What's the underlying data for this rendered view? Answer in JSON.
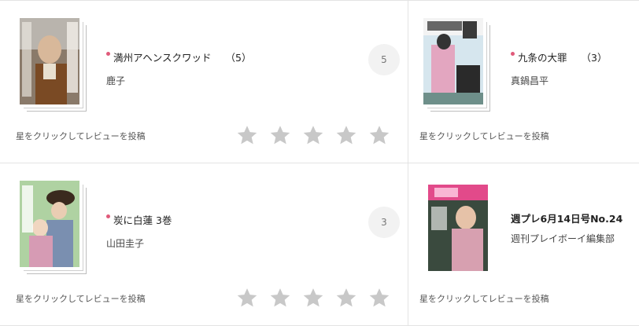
{
  "colors": {
    "accent_dot": "#e05a7a",
    "star": "#c8c8c8",
    "badge_bg": "#f2f2f2"
  },
  "cards": [
    {
      "title": "満州アヘンスクワッド",
      "volume": "（5）",
      "author": "鹿子",
      "badge": "5",
      "prompt": "星をクリックしてレビューを投稿",
      "stars": 5,
      "has_dot": true
    },
    {
      "title": "九条の大罪",
      "volume": "（3）",
      "author": "真鍋昌平",
      "prompt": "星をクリックしてレビューを投稿",
      "has_dot": true
    },
    {
      "title": "炭に白蓮 3巻",
      "author": "山田圭子",
      "badge": "3",
      "prompt": "星をクリックしてレビューを投稿",
      "stars": 5,
      "has_dot": true
    },
    {
      "title": "週プレ6月14日号No.24",
      "author": "週刊プレイボーイ編集部",
      "prompt": "星をクリックしてレビューを投稿",
      "has_dot": false
    }
  ],
  "icons": [
    "star-icon"
  ]
}
